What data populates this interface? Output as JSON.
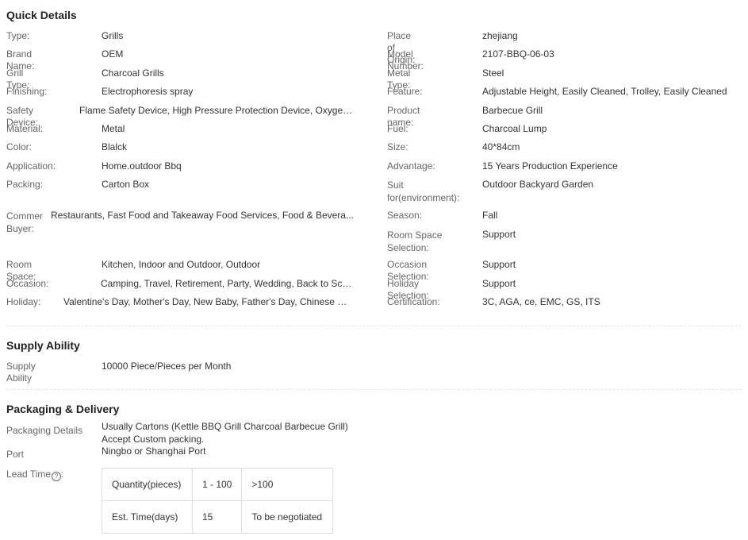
{
  "quick_details": {
    "title": "Quick Details",
    "left": [
      {
        "label": "Type:",
        "value": "Grills"
      },
      {
        "label": "Brand Name:",
        "value": "OEM"
      },
      {
        "label": "Grill Type:",
        "value": "Charcoal Grills"
      },
      {
        "label": "Finishing:",
        "value": "Electrophoresis spray"
      },
      {
        "label": "Safety Device:",
        "value": "Flame Safety Device, High Pressure Protection Device, Oxygen ..."
      },
      {
        "label": "Material:",
        "value": "Metal"
      },
      {
        "label": "Color:",
        "value": "Blalck"
      },
      {
        "label": "Application:",
        "value": "Home.outdoor Bbq"
      },
      {
        "label": "Packing:",
        "value": "Carton Box"
      },
      {
        "label": "Commer Buyer:",
        "value": "Restaurants, Fast Food and Takeaway Food Services, Food & Bevera..."
      },
      {
        "label": "Room Space:",
        "value": "Kitchen, Indoor and Outdoor, Outdoor"
      },
      {
        "label": "Occasion:",
        "value": "Camping, Travel, Retirement, Party, Wedding, Back to Sch..."
      },
      {
        "label": "Holiday:",
        "value": "Valentine's Day, Mother's Day, New Baby, Father's Day, Chinese Ne..."
      }
    ],
    "right": [
      {
        "label": "Place of Origin:",
        "value": "zhejiang"
      },
      {
        "label": "Model Number:",
        "value": "2107-BBQ-06-03"
      },
      {
        "label": "Metal Type:",
        "value": "Steel"
      },
      {
        "label": "Feature:",
        "value": "Adjustable Height, Easily Cleaned, Trolley, Easily Cleaned"
      },
      {
        "label": "Product name:",
        "value": "Barbecue Grill"
      },
      {
        "label": "Fuel:",
        "value": "Charcoal Lump"
      },
      {
        "label": "Size:",
        "value": "40*84cm"
      },
      {
        "label": "Advantage:",
        "value": "15 Years Production Experience"
      },
      {
        "label": "Suit for(environment):",
        "value": "Outdoor Backyard Garden"
      },
      {
        "label": "Season:",
        "value": "Fall"
      },
      {
        "label": "Room Space Selection:",
        "value": "Support"
      },
      {
        "label": "Occasion Selection:",
        "value": "Support"
      },
      {
        "label": "Holiday Selection:",
        "value": "Support"
      },
      {
        "label": "Certification:",
        "value": "3C, AGA, ce, EMC, GS, ITS"
      }
    ]
  },
  "supply": {
    "title": "Supply Ability",
    "label": "Supply Ability",
    "value": "10000 Piece/Pieces per Month"
  },
  "packaging": {
    "title": "Packaging & Delivery",
    "details_label": "Packaging Details",
    "details_line1": "Usually Cartons (Kettle BBQ Grill Charcoal Barbecue Grill)",
    "details_line2": "Accept Custom packing.",
    "port_label": "Port",
    "port_value": "Ningbo or Shanghai Port",
    "lead_label": "Lead Time",
    "help_icon": "?",
    "lead_table": {
      "row1": [
        "Quantity(pieces)",
        "1 - 100",
        ">100"
      ],
      "row2": [
        "Est. Time(days)",
        "15",
        "To be negotiated"
      ]
    }
  }
}
